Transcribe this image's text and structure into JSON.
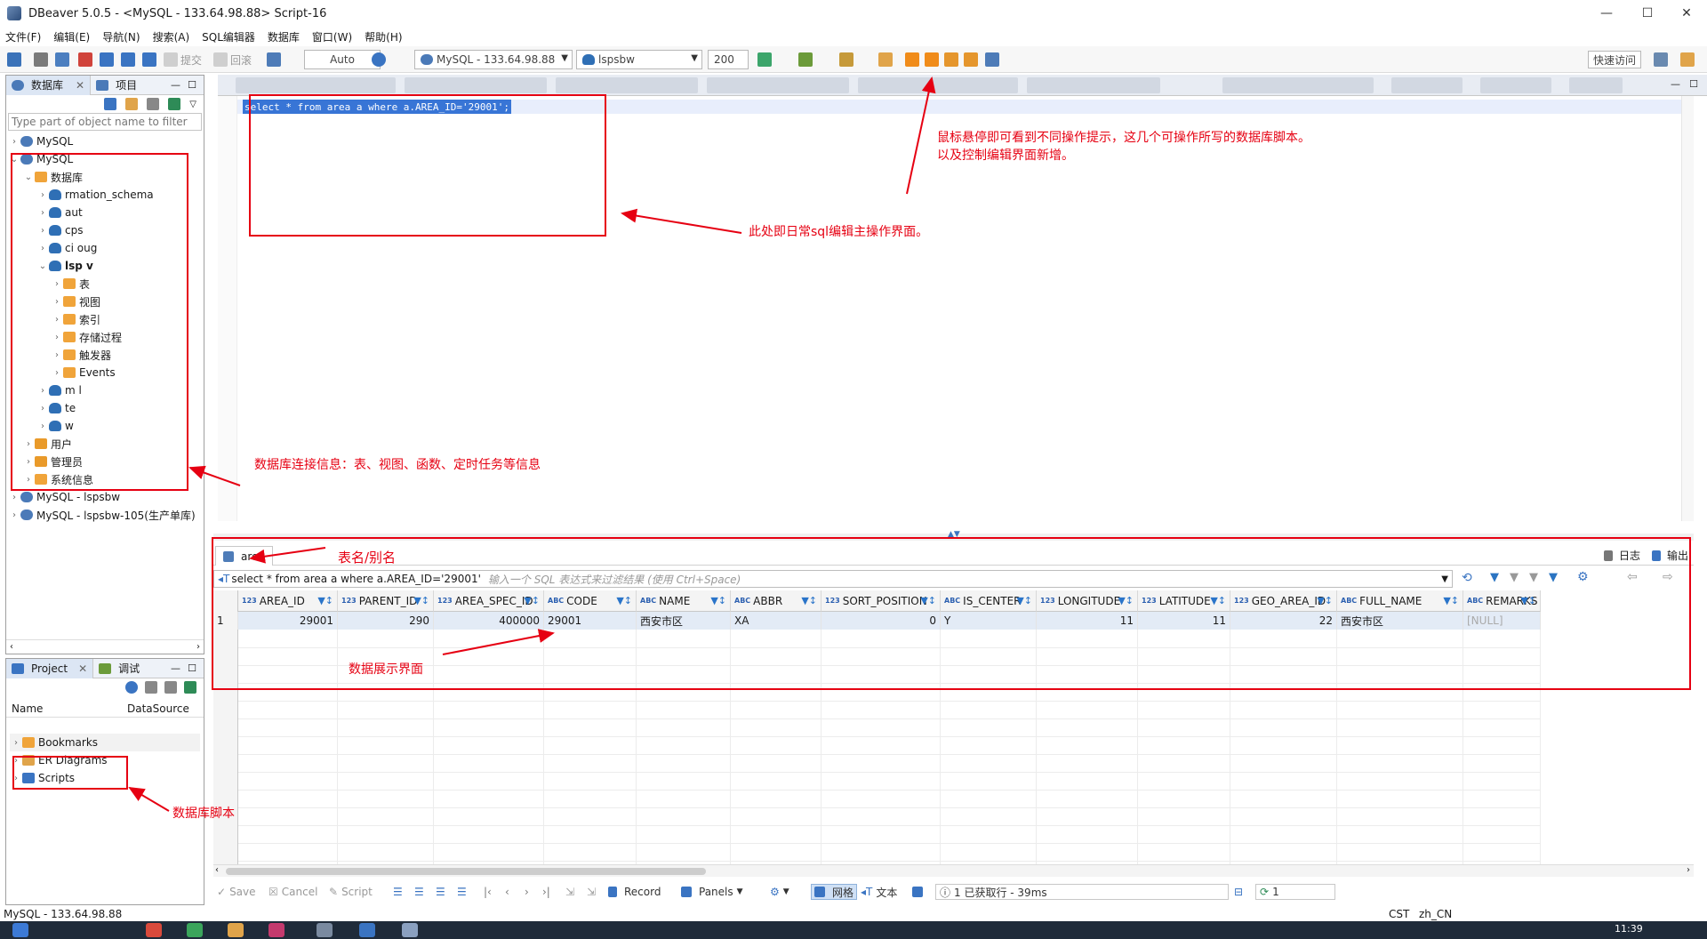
{
  "window": {
    "title": "DBeaver 5.0.5 - <MySQL - 133.64.98.88> Script-16",
    "minimize": "—",
    "maximize": "☐",
    "close": "✕"
  },
  "menu": [
    "文件(F)",
    "编辑(E)",
    "导航(N)",
    "搜索(A)",
    "SQL编辑器",
    "数据库",
    "窗口(W)",
    "帮助(H)"
  ],
  "toolbar": {
    "commit": "提交",
    "rollback": "回滚",
    "transaction_mode": "Auto",
    "connection": "MySQL - 133.64.98.88",
    "schema": "lspsbw",
    "fetch_size": "200",
    "quick_access": "快速访问"
  },
  "navigator": {
    "tab_db": "数据库",
    "tab_project": "项目",
    "filter_placeholder": "Type part of object name to filter",
    "tree": [
      {
        "label": "MySQL",
        "depth": 0,
        "type": "conn",
        "expanded": false
      },
      {
        "label": "MySQL",
        "depth": 0,
        "type": "conn",
        "expanded": true
      },
      {
        "label": "数据库",
        "depth": 1,
        "type": "folder",
        "expanded": true
      },
      {
        "label": "rmation_schema",
        "depth": 2,
        "type": "db",
        "expanded": false
      },
      {
        "label": "aut",
        "depth": 2,
        "type": "db",
        "expanded": false
      },
      {
        "label": "cps",
        "depth": 2,
        "type": "db",
        "expanded": false
      },
      {
        "label": "ci   oug",
        "depth": 2,
        "type": "db",
        "expanded": false
      },
      {
        "label": "lsp   v",
        "depth": 2,
        "type": "db",
        "expanded": true,
        "bold": true
      },
      {
        "label": "表",
        "depth": 3,
        "type": "folder",
        "expanded": false
      },
      {
        "label": "视图",
        "depth": 3,
        "type": "folder",
        "expanded": false
      },
      {
        "label": "索引",
        "depth": 3,
        "type": "folder",
        "expanded": false
      },
      {
        "label": "存储过程",
        "depth": 3,
        "type": "folder",
        "expanded": false
      },
      {
        "label": "触发器",
        "depth": 3,
        "type": "folder",
        "expanded": false
      },
      {
        "label": "Events",
        "depth": 3,
        "type": "folder",
        "expanded": false
      },
      {
        "label": "m   l",
        "depth": 2,
        "type": "db",
        "expanded": false
      },
      {
        "label": "te",
        "depth": 2,
        "type": "db",
        "expanded": false
      },
      {
        "label": "w",
        "depth": 2,
        "type": "db",
        "expanded": false
      },
      {
        "label": "用户",
        "depth": 1,
        "type": "user",
        "expanded": false
      },
      {
        "label": "管理员",
        "depth": 1,
        "type": "user",
        "expanded": false
      },
      {
        "label": "系统信息",
        "depth": 1,
        "type": "folder",
        "expanded": false
      },
      {
        "label": "MySQL - lspsbw",
        "depth": 0,
        "type": "conn",
        "expanded": false
      },
      {
        "label": "MySQL - lspsbw-105(生产单库)",
        "depth": 0,
        "type": "conn",
        "expanded": false
      }
    ]
  },
  "project_panel": {
    "tab_project": "Project",
    "tab_debug": "调试",
    "col_name": "Name",
    "col_datasource": "DataSource",
    "items": [
      "Bookmarks",
      "ER Diagrams",
      "Scripts"
    ]
  },
  "editor": {
    "sql": "select * from area a where a.AREA_ID='29001';"
  },
  "annotations": {
    "hover_tip_line1": "鼠标悬停即可看到不同操作提示，这几个可操作所写的数据库脚本。",
    "hover_tip_line2": "以及控制编辑界面新增。",
    "editor_tip": "此处即日常sql编辑主操作界面。",
    "db_info_tip": "数据库连接信息：表、视图、函数、定时任务等信息",
    "table_alias_tip": "表名/别名",
    "data_tip": "数据展示界面",
    "scripts_tip": "数据库脚本"
  },
  "results": {
    "tab": "area",
    "log": "日志",
    "output": "输出",
    "filter_query": "select * from area a where a.AREA_ID='29001'",
    "filter_placeholder": "输入一个 SQL 表达式来过滤结果 (使用 Ctrl+Space)",
    "columns": [
      {
        "type": "123",
        "name": "AREA_ID"
      },
      {
        "type": "123",
        "name": "PARENT_ID"
      },
      {
        "type": "123",
        "name": "AREA_SPEC_ID"
      },
      {
        "type": "ABC",
        "name": "CODE"
      },
      {
        "type": "ABC",
        "name": "NAME"
      },
      {
        "type": "ABC",
        "name": "ABBR"
      },
      {
        "type": "123",
        "name": "SORT_POSITION"
      },
      {
        "type": "ABC",
        "name": "IS_CENTER"
      },
      {
        "type": "123",
        "name": "LONGITUDE"
      },
      {
        "type": "123",
        "name": "LATITUDE"
      },
      {
        "type": "123",
        "name": "GEO_AREA_ID"
      },
      {
        "type": "ABC",
        "name": "FULL_NAME"
      },
      {
        "type": "ABC",
        "name": "REMARKS"
      }
    ],
    "rows": [
      {
        "num": "1",
        "cells": [
          "29001",
          "290",
          "400000",
          "29001",
          "西安市区",
          "XA",
          "0",
          "Y",
          "11",
          "11",
          "22",
          "西安市区",
          "[NULL]"
        ]
      }
    ]
  },
  "bottom_toolbar": {
    "save": "Save",
    "cancel": "Cancel",
    "script": "Script",
    "record": "Record",
    "panels": "Panels",
    "grid": "网格",
    "text": "文本",
    "status": "1 已获取行 - 39ms",
    "count": "1"
  },
  "statusbar": {
    "connection": "MySQL - 133.64.98.88",
    "tz": "CST",
    "locale": "zh_CN"
  },
  "taskbar": {
    "time": "11:39"
  },
  "colors": {
    "annotation_red": "#e60012",
    "selection_blue": "#3875d6"
  }
}
